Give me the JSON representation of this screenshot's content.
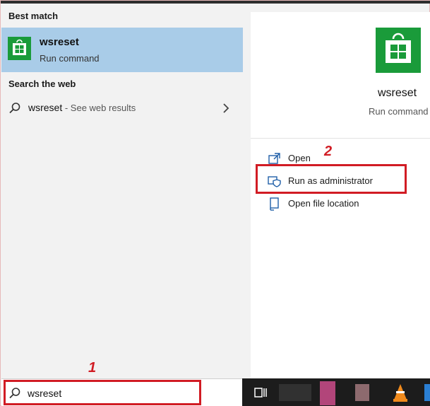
{
  "left": {
    "best_match_label": "Best match",
    "best_item": {
      "title": "wsreset",
      "subtitle": "Run command",
      "icon": "store-icon"
    },
    "web_label": "Search the web",
    "web_item": {
      "query": "wsreset",
      "hint": " - See web results"
    }
  },
  "right": {
    "title": "wsreset",
    "subtitle": "Run command",
    "actions": [
      {
        "label": "Open",
        "icon": "open-icon"
      },
      {
        "label": "Run as administrator",
        "icon": "shield-icon"
      },
      {
        "label": "Open file location",
        "icon": "file-location-icon"
      }
    ]
  },
  "search": {
    "value": "wsreset"
  },
  "annotations": {
    "step1": "1",
    "step2": "2"
  },
  "colors": {
    "highlight": "#a9cce8",
    "store_green": "#1a9b3a",
    "annotation_red": "#d11c24",
    "taskbar": "#1c1c1c"
  }
}
